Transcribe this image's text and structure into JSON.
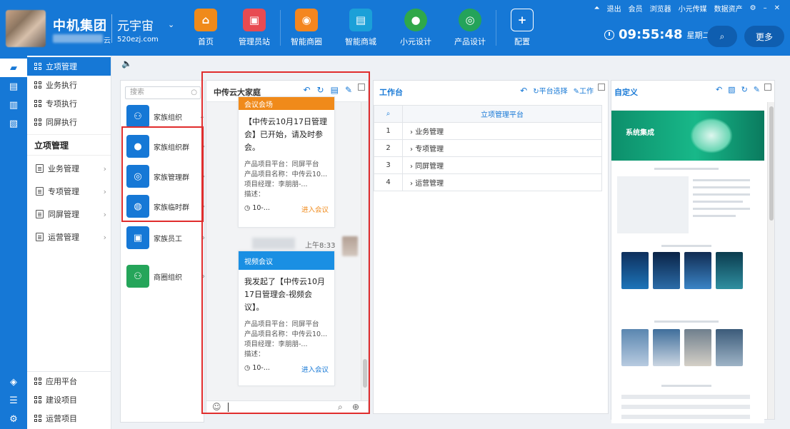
{
  "header": {
    "company": "中机集团",
    "company_tail": "云",
    "brand": "元宇宙",
    "brand_url": "520ezj.com",
    "nav": [
      {
        "label": "首页",
        "color": "#f08a1a",
        "glyph": "⌂"
      },
      {
        "label": "管理员站",
        "color": "#e84b52",
        "glyph": "▣"
      },
      {
        "label": "智能商圈",
        "color": "#f4861f",
        "glyph": "◉"
      },
      {
        "label": "智能商城",
        "color": "#1ba0d8",
        "glyph": "🛒"
      },
      {
        "label": "小元设计",
        "color": "#2fa84a",
        "glyph": "●"
      },
      {
        "label": "产品设计",
        "color": "#24a35a",
        "glyph": "◎"
      },
      {
        "label": "配置",
        "color": "#1678d6",
        "glyph": "+"
      }
    ],
    "window_links": [
      "退出",
      "会员",
      "浏览器",
      "小元传媒",
      "数据资产"
    ],
    "clock": "09:55:48",
    "weekday": "星期二",
    "more": "更多"
  },
  "iconbar": {
    "top": [
      "briefcase-icon",
      "monitor-icon",
      "chart-icon",
      "screen-icon"
    ],
    "bottom": [
      "cube-icon",
      "list-icon",
      "settings-icon"
    ]
  },
  "leftnav": {
    "top_items": [
      {
        "label": "立项管理",
        "active": true
      },
      {
        "label": "业务执行",
        "active": false
      },
      {
        "label": "专项执行",
        "active": false
      },
      {
        "label": "同屏执行",
        "active": false
      }
    ],
    "section_title": "立项管理",
    "sub_items": [
      "业务管理",
      "专项管理",
      "同屏管理",
      "运营管理"
    ],
    "bottom_items": [
      "应用平台",
      "建设项目",
      "运营项目"
    ]
  },
  "contacts": {
    "search_placeholder": "搜索",
    "items": [
      {
        "label": "家族组织",
        "color": "#1678d6",
        "glyph": "⚇"
      },
      {
        "label": "家族组织群",
        "color": "#1678d6",
        "glyph": "👤"
      },
      {
        "label": "家族管理群",
        "color": "#1678d6",
        "glyph": "◎"
      },
      {
        "label": "家族临时群",
        "color": "#1678d6",
        "glyph": "◍"
      },
      {
        "label": "家族员工",
        "color": "#1678d6",
        "glyph": "▣"
      },
      {
        "label": "商圈组织",
        "color": "#25a55a",
        "glyph": "⚇"
      }
    ]
  },
  "chat": {
    "title": "中传云大家庭",
    "card1": {
      "head": "会议会场",
      "head_color": "#f08a1a",
      "body": "【中传云10月17日管理会】已开始，请及时参会。",
      "meta": [
        "产品项目平台：同屏平台",
        "产品项目名称：中传云10...",
        "项目经理：李朋朋-...",
        "描述："
      ],
      "time": "10-...",
      "action": "进入会议",
      "action_color": "#f08a1a"
    },
    "msg_time": "上午8:33",
    "card2": {
      "head": "视频会议",
      "head_color": "#1a8fe3",
      "body": "我发起了【中传云10月17日管理会-视频会议】。",
      "meta": [
        "产品项目平台：同屏平台",
        "产品项目名称：中传云10...",
        "项目经理：李朋朋-...",
        "描述："
      ],
      "time": "10-...",
      "action": "进入会议",
      "action_color": "#1678d6"
    }
  },
  "workbench": {
    "title": "工作台",
    "tool_platform": "平台选择",
    "tool_work": "工作",
    "header": "立项管理平台",
    "rows": [
      {
        "num": "1",
        "label": "业务管理"
      },
      {
        "num": "2",
        "label": "专项管理"
      },
      {
        "num": "3",
        "label": "同屏管理"
      },
      {
        "num": "4",
        "label": "运营管理"
      }
    ]
  },
  "custom": {
    "title": "自定义",
    "hero_text": "系统集成"
  }
}
